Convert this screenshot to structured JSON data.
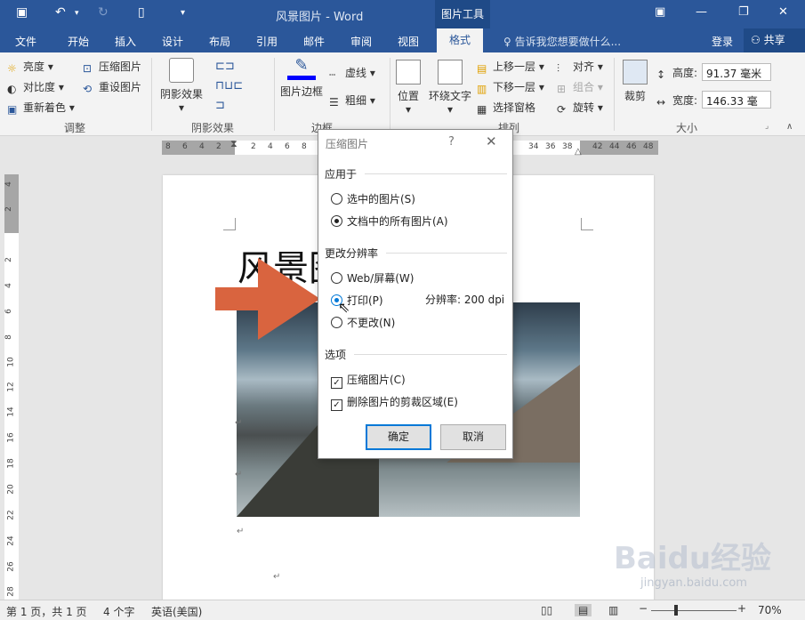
{
  "window": {
    "doc_title": "风景图片 - Word",
    "context_tab": "图片工具"
  },
  "tabs": [
    "文件",
    "开始",
    "插入",
    "设计",
    "布局",
    "引用",
    "邮件",
    "审阅",
    "视图",
    "格式"
  ],
  "tell_me": "告诉我您想要做什么...",
  "login": "登录",
  "share": "共享",
  "ribbon": {
    "adjust": {
      "brightness": "亮度",
      "contrast": "对比度",
      "recolor": "重新着色",
      "compress": "压缩图片",
      "reset": "重设图片",
      "label": "调整"
    },
    "shadow": {
      "shadow_effects": "阴影效果",
      "label": "阴影效果"
    },
    "border": {
      "picture_border": "图片边框",
      "dashes": "虚线",
      "weight": "粗细",
      "label": "边框"
    },
    "arrange": {
      "position": "位置",
      "wrap": "环绕文字",
      "bring_forward": "上移一层",
      "send_backward": "下移一层",
      "selection_pane": "选择窗格",
      "align": "对齐",
      "group": "组合",
      "rotate": "旋转",
      "label": "排列"
    },
    "size": {
      "crop": "裁剪",
      "height_label": "高度:",
      "height_value": "91.37 毫米",
      "width_label": "宽度:",
      "width_value": "146.33 毫",
      "label": "大小"
    }
  },
  "ruler": {
    "ticks": [
      "8",
      "6",
      "4",
      "2",
      "2",
      "4",
      "6",
      "8",
      "34",
      "36",
      "38",
      "42",
      "44",
      "46",
      "48"
    ],
    "vticks": [
      "4",
      "2",
      "2",
      "4",
      "6",
      "8",
      "10",
      "12",
      "14",
      "16",
      "18",
      "20",
      "22",
      "24",
      "26",
      "28"
    ],
    "corner": "L"
  },
  "document": {
    "title_visible": "风景图"
  },
  "dialog": {
    "title": "压缩图片",
    "help": "?",
    "close": "✕",
    "apply_to": "应用于",
    "opt_selected": "选中的图片(S)",
    "opt_all": "文档中的所有图片(A)",
    "change_res": "更改分辨率",
    "opt_web": "Web/屏幕(W)",
    "opt_print": "打印(P)",
    "opt_nochange": "不更改(N)",
    "resolution": "分辨率:  200 dpi",
    "options": "选项",
    "chk_compress": "压缩图片(C)",
    "chk_delete_crop": "删除图片的剪裁区域(E)",
    "ok": "确定",
    "cancel": "取消"
  },
  "status": {
    "page": "第 1 页，共 1 页",
    "words": "4 个字",
    "language": "英语(美国)",
    "zoom": "70%"
  },
  "watermark": {
    "logo": "Baidu经验",
    "url": "jingyan.baidu.com"
  }
}
